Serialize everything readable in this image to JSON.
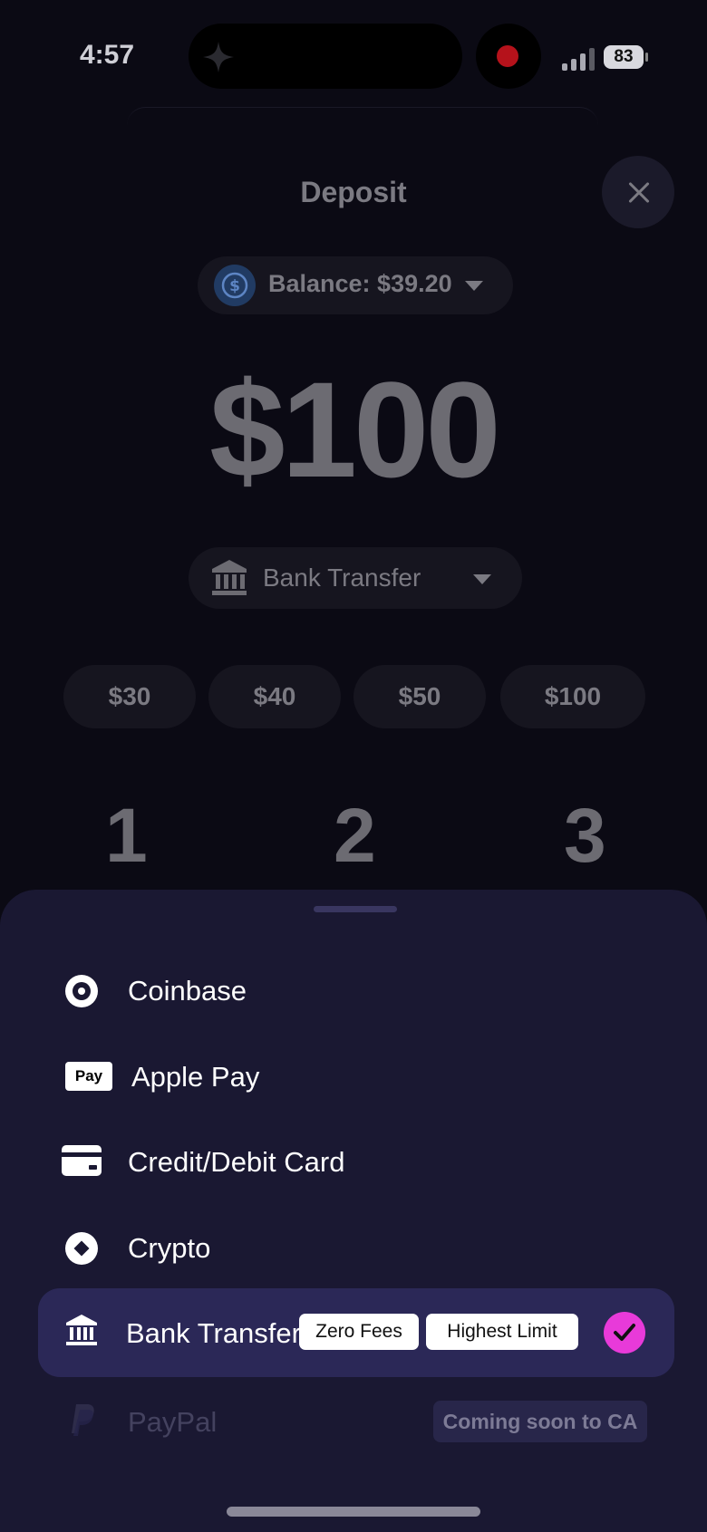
{
  "status_bar": {
    "time": "4:57",
    "battery": "83"
  },
  "header": {
    "title": "Deposit",
    "close_icon": "close-icon"
  },
  "balance": {
    "label": "Balance: $39.20",
    "icon": "usdc-coin-icon"
  },
  "amount": {
    "value": "$100"
  },
  "method_selector": {
    "label": "Bank Transfer",
    "icon": "bank-icon"
  },
  "presets": [
    "$30",
    "$40",
    "$50",
    "$100"
  ],
  "keypad": [
    "1",
    "2",
    "3"
  ],
  "sheet": {
    "options": [
      {
        "label": "Coinbase",
        "icon": "coinbase-icon"
      },
      {
        "label": "Apple Pay",
        "icon": "apple-pay-icon",
        "icon_text": "Pay"
      },
      {
        "label": "Credit/Debit Card",
        "icon": "credit-card-icon"
      },
      {
        "label": "Crypto",
        "icon": "crypto-icon"
      },
      {
        "label": "Bank Transfer",
        "icon": "bank-icon",
        "selected": true,
        "badges": [
          "Zero Fees",
          "Highest Limit"
        ]
      },
      {
        "label": "PayPal",
        "icon": "paypal-icon",
        "disabled": true,
        "note": "Coming soon to CA"
      }
    ]
  },
  "colors": {
    "sheet_bg": "#1a1832",
    "selected_bg": "#2b2857",
    "accent_check": "#e83ad9"
  }
}
